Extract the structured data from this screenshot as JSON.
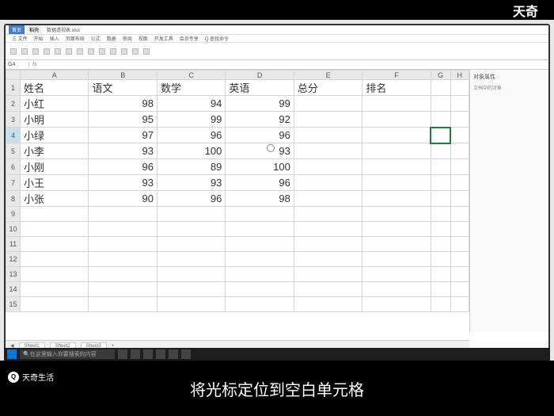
{
  "brand_tr": "天奇",
  "brand_bl": "天奇生活",
  "subtitle": "将光标定位到空白单元格",
  "wps": {
    "tab1": "首页",
    "tab2": "稻壳",
    "filename": "数据透视表.xlsx",
    "ribbon_tabs": [
      "三 文件",
      "开始",
      "插入",
      "页面布局",
      "公式",
      "数据",
      "审阅",
      "视图",
      "开发工具",
      "会员专享",
      "Q 查找命令"
    ],
    "name_box": "G4",
    "fx": "fx"
  },
  "taskbar": {
    "search_placeholder": "在这里输入你要搜索的内容"
  },
  "side_panel": {
    "header": "对象属性 ·",
    "sub": "文档中的对象"
  },
  "sheet_tabs": [
    "Sheet1",
    "Sheet2",
    "Sheet3"
  ],
  "chart_data": {
    "type": "table",
    "columns": [
      "A",
      "B",
      "C",
      "D",
      "E",
      "F",
      "G",
      "H"
    ],
    "headers": [
      "姓名",
      "语文",
      "数学",
      "英语",
      "总分",
      "排名"
    ],
    "rows": [
      {
        "name": "小红",
        "chinese": 98,
        "math": 94,
        "english": 99
      },
      {
        "name": "小明",
        "chinese": 95,
        "math": 99,
        "english": 92
      },
      {
        "name": "小绿",
        "chinese": 97,
        "math": 96,
        "english": 96
      },
      {
        "name": "小李",
        "chinese": 93,
        "math": 100,
        "english": 93
      },
      {
        "name": "小刚",
        "chinese": 96,
        "math": 89,
        "english": 100
      },
      {
        "name": "小王",
        "chinese": 93,
        "math": 93,
        "english": 96
      },
      {
        "name": "小张",
        "chinese": 90,
        "math": 96,
        "english": 98
      }
    ],
    "selected_cell": "G4",
    "row_headers": [
      1,
      2,
      3,
      4,
      5,
      6,
      7,
      8,
      9,
      10,
      11,
      12,
      13,
      14,
      15
    ]
  }
}
